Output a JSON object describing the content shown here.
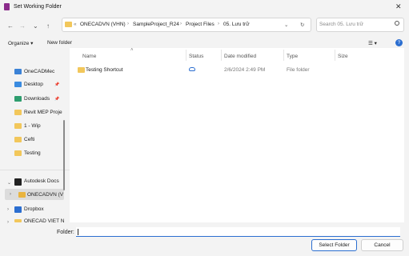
{
  "window": {
    "title": "Set Working Folder",
    "close_glyph": "✕"
  },
  "nav": {
    "back": "←",
    "forward": "→",
    "down": "⌄",
    "up": "↑"
  },
  "address": {
    "prefix": "«",
    "crumbs": [
      "ONECADVN (VHN)",
      "SampleProject_R24",
      "Project Files",
      "05. Lưu trữ"
    ],
    "chevron": "⌄",
    "refresh": "↻"
  },
  "search": {
    "placeholder": "Search 05. Lưu trữ"
  },
  "toolbar": {
    "organize": "Organize ▾",
    "new_folder": "New folder",
    "view": "☰ ▾",
    "help": "?"
  },
  "columns": {
    "name": "Name",
    "status": "Status",
    "date": "Date modified",
    "type": "Type",
    "size": "Size"
  },
  "files": [
    {
      "name": "Testing Shortcut",
      "status_icon": "cloud-icon",
      "date": "2/6/2024 2:49 PM",
      "type": "File folder",
      "size": ""
    }
  ],
  "sidebar": {
    "items": [
      {
        "label": "OneCADMec",
        "icon": "cloud-folder-icon"
      },
      {
        "label": "Desktop",
        "icon": "desktop-icon",
        "pinned": true
      },
      {
        "label": "Downloads",
        "icon": "download-icon",
        "pinned": true
      },
      {
        "label": "Revit MEP Proje",
        "icon": "folder-icon"
      },
      {
        "label": "1 - Wip",
        "icon": "folder-icon"
      },
      {
        "label": "Cefti",
        "icon": "folder-icon"
      },
      {
        "label": "Testing",
        "icon": "folder-icon"
      },
      {
        "label": "Autodesk Docs",
        "icon": "autodesk-icon"
      },
      {
        "label": "ONECADVN (V",
        "icon": "folder-icon",
        "selected": true
      },
      {
        "label": "Dropbox",
        "icon": "dropbox-icon"
      },
      {
        "label": "ONECAD VIET N",
        "icon": "folder-icon"
      }
    ]
  },
  "footer": {
    "folder_label": "Folder:",
    "folder_value": "",
    "select_button": "Select Folder",
    "cancel_button": "Cancel"
  },
  "colors": {
    "accent": "#2b6ed0",
    "folder": "#f2c75b",
    "app_icon": "#8a2b8a"
  }
}
